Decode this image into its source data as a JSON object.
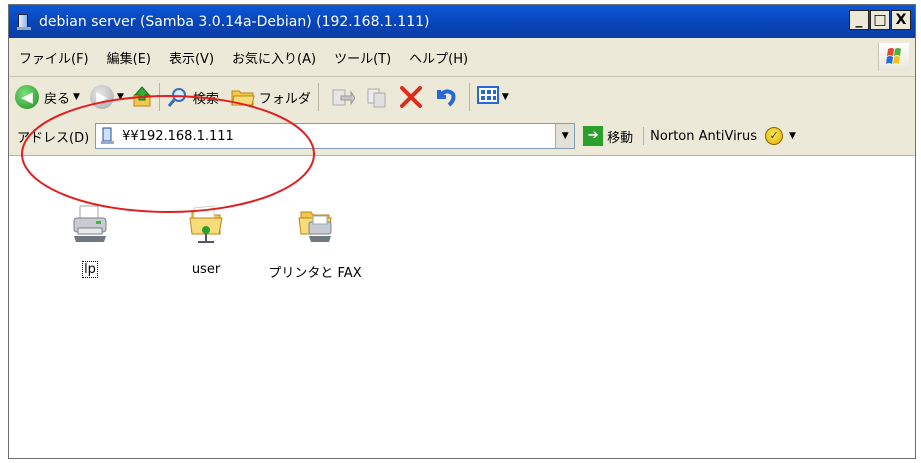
{
  "window": {
    "title": "debian server (Samba 3.0.14a-Debian) (192.168.1.111)",
    "buttons": {
      "minimize": "_",
      "maximize": "□",
      "close": "X"
    }
  },
  "menu": {
    "items": [
      "ファイル(F)",
      "編集(E)",
      "表示(V)",
      "お気に入り(A)",
      "ツール(T)",
      "ヘルプ(H)"
    ]
  },
  "toolbar": {
    "back_label": "戻る",
    "search_label": "検索",
    "folders_label": "フォルダ"
  },
  "address": {
    "label": "アドレス(D)",
    "value": "¥¥192.168.1.111",
    "go_label": "移動",
    "norton_label": "Norton AntiVirus"
  },
  "content": {
    "items": [
      {
        "label": "lp",
        "icon": "printer-share-icon"
      },
      {
        "label": "user",
        "icon": "shared-folder-icon"
      },
      {
        "label": "プリンタと FAX",
        "icon": "printers-faxes-folder-icon"
      }
    ]
  },
  "colors": {
    "titlebar": "#0a58d8",
    "chrome": "#ece9d8",
    "annotation": "#e02020"
  }
}
